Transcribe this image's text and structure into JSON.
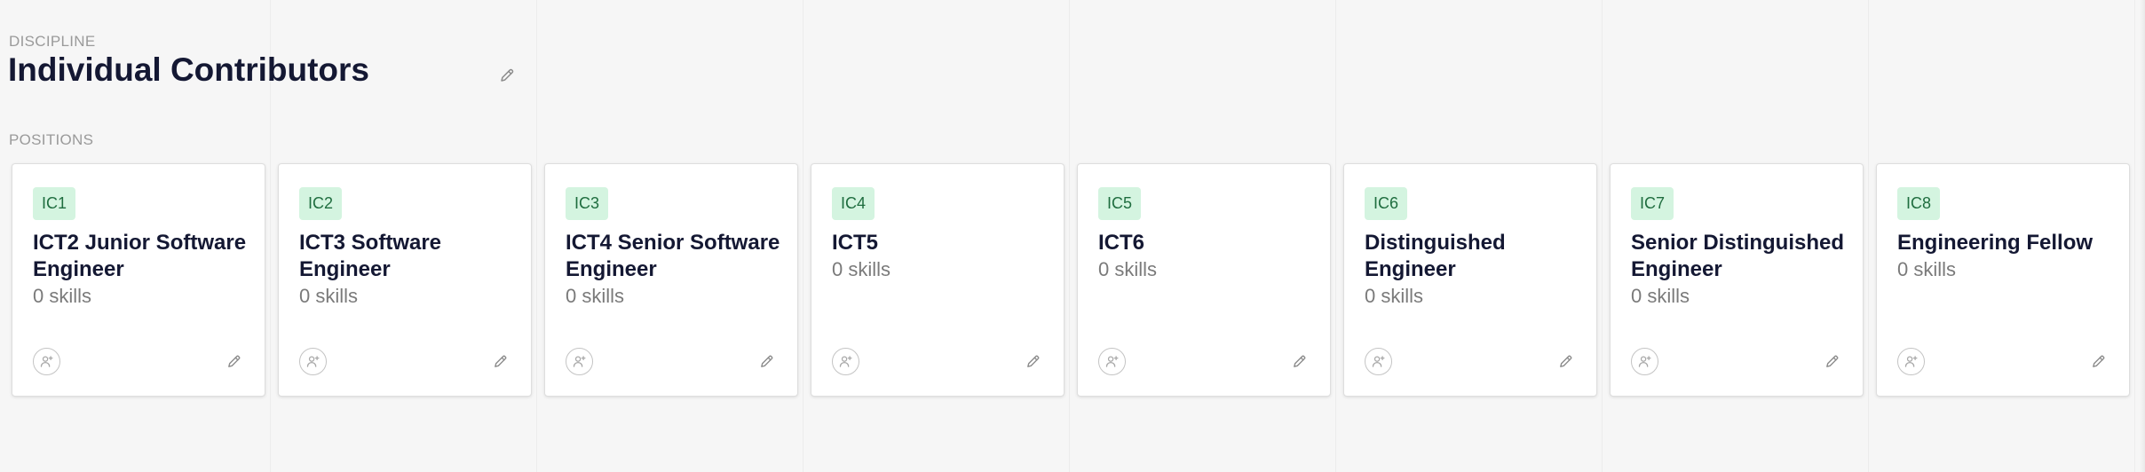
{
  "discipline": {
    "overline": "DISCIPLINE",
    "title": "Individual Contributors",
    "edit_icon": "pencil-icon"
  },
  "positions": {
    "overline": "POSITIONS",
    "cards": [
      {
        "level": "IC1",
        "title": "ICT2 Junior Software Engineer",
        "skills": "0 skills"
      },
      {
        "level": "IC2",
        "title": "ICT3 Software Engineer",
        "skills": "0 skills"
      },
      {
        "level": "IC3",
        "title": "ICT4 Senior Software Engineer",
        "skills": "0 skills"
      },
      {
        "level": "IC4",
        "title": "ICT5",
        "skills": "0 skills"
      },
      {
        "level": "IC5",
        "title": "ICT6",
        "skills": "0 skills"
      },
      {
        "level": "IC6",
        "title": "Distinguished Engineer",
        "skills": "0 skills"
      },
      {
        "level": "IC7",
        "title": "Senior Distinguished Engineer",
        "skills": "0 skills"
      },
      {
        "level": "IC8",
        "title": "Engineering Fellow",
        "skills": "0 skills"
      }
    ],
    "assign_icon": "person-add-icon",
    "edit_icon": "pencil-icon"
  },
  "colors": {
    "badge_bg": "#d4f4e0",
    "badge_text": "#1f6d3f",
    "title": "#141833",
    "muted": "#7a7a7a"
  }
}
